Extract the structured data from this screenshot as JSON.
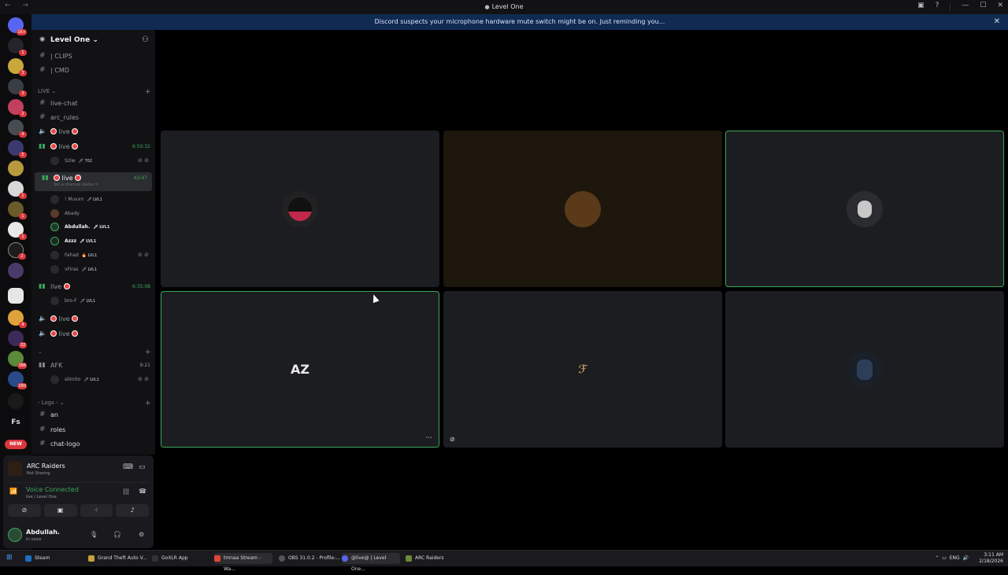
{
  "window": {
    "title": "Level One",
    "nav": "← →",
    "controls": [
      "▣",
      "?",
      "—",
      "☐",
      "✕"
    ]
  },
  "notice": {
    "text": "Discord suspects your microphone hardware mute switch might be on. Just reminding you...",
    "close": "✕"
  },
  "servers": {
    "top_badge": "1K+",
    "badges": [
      "1",
      "3",
      "3",
      "2",
      "4",
      "5",
      "1",
      "1",
      "1",
      "2",
      "4",
      "32",
      "386",
      "280"
    ],
    "label_fs": "Fs",
    "new_label": "NEW"
  },
  "sidebar": {
    "server_name": "Level One ⌄",
    "rows": {
      "clips": "| CLIPS",
      "cmd": "| CMD",
      "cat_live": "LIVE ⌄",
      "live_chat": "live-chat",
      "arc_rules": "arc_rules",
      "live": "live",
      "timer1": "6:50:32",
      "timer2": "43:47",
      "set_status": "Set a channel status ✎",
      "timer3": "6:35:08",
      "cat_arrow": "⌄",
      "afk": "AFK",
      "timer4": "9:21",
      "cat_logs": "- Logs - ⌄",
      "an": "an",
      "roles": "roles",
      "chat_logo": "chat-logo"
    },
    "members": [
      {
        "name": "Szlw",
        "tag": "🗡 702"
      },
      {
        "name": "! Muvxn",
        "tag": "🗡 LVL1"
      },
      {
        "name": "Abady",
        "tag": ""
      },
      {
        "name": "Abdullah.",
        "tag": "🗡 LVL1"
      },
      {
        "name": "Azzz",
        "tag": "🗡 LVL1"
      },
      {
        "name": "Fahad",
        "tag": "🔥 LVL1"
      },
      {
        "name": "vFiras",
        "tag": "🗡 LVL1"
      },
      {
        "name": "bro-F",
        "tag": "🗡 LVL1"
      },
      {
        "name": "sōmito",
        "tag": "🗡 LVL1"
      }
    ]
  },
  "panel": {
    "game_title": "ARC Raiders",
    "game_status": "Not Sharing",
    "voice_title": "Voice Connected",
    "voice_channel": "live / Level One",
    "user_name": "Abdullah.",
    "user_status": "In voice"
  },
  "tiles": {
    "az_label": "AZ",
    "more": "···"
  },
  "taskbar": {
    "items": [
      "Steam",
      "Grand Theft Auto V...",
      "GoXLR App",
      "tmnaa Stream - Wa...",
      "OBS 31.0.2 - Profile:...",
      "@live@ | Level One...",
      "ARC Raiders"
    ],
    "lang": "ENG",
    "time": "3:11 AM",
    "date": "2/18/2026"
  }
}
